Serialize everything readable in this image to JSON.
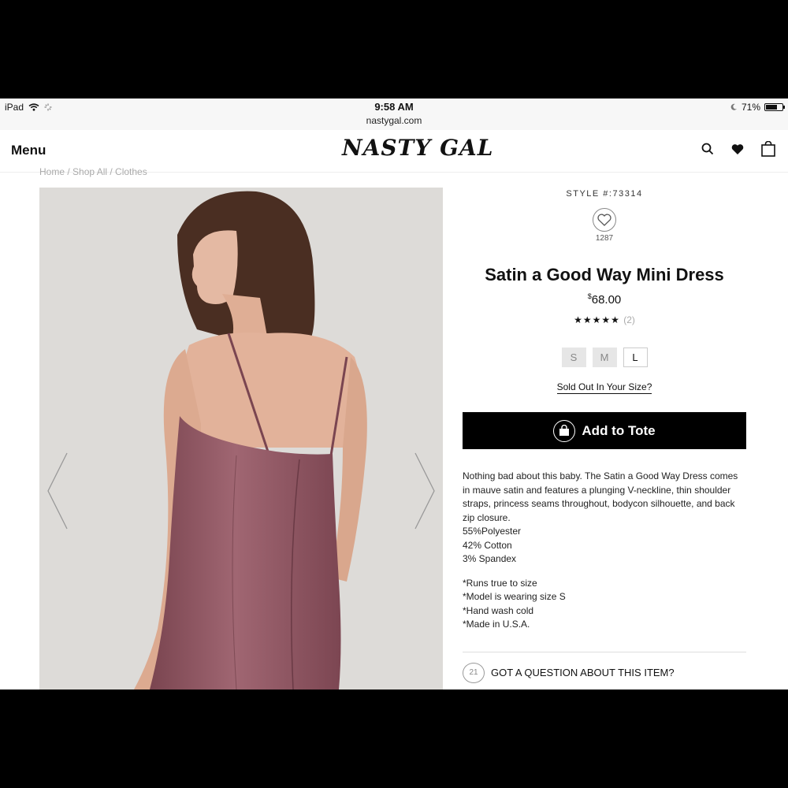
{
  "status_bar": {
    "device": "iPad",
    "time": "9:58 AM",
    "url": "nastygal.com",
    "battery": "71%",
    "battery_level": 0.71
  },
  "header": {
    "menu_label": "Menu",
    "logo_text": "NASTY GAL",
    "icons": [
      "search-icon",
      "heart-icon",
      "bag-icon"
    ]
  },
  "breadcrumb": "Home / Shop All / Clothes",
  "product": {
    "style_number": "STYLE #:73314",
    "favorites_count": "1287",
    "title": "Satin a Good Way Mini Dress",
    "price_currency": "$",
    "price_value": "68.00",
    "stars": "★★★★★",
    "review_count": "(2)",
    "sizes": [
      "S",
      "M",
      "L"
    ],
    "sold_out_link": "Sold Out In Your Size?",
    "add_to_tote_label": "Add to Tote",
    "description": "Nothing bad about this baby. The Satin a Good Way Dress comes in mauve satin and features a plunging V-neckline, thin shoulder straps, princess seams throughout, bodycon silhouette, and back zip closure.",
    "composition": [
      "55%Polyester",
      "42% Cotton",
      "3% Spandex"
    ],
    "notes": [
      "*Runs true to size",
      "*Model is wearing size S",
      "*Hand wash cold",
      "*Made in U.S.A."
    ],
    "question_count": "21",
    "question_label": "GOT A QUESTION ABOUT THIS ITEM?"
  },
  "colors": {
    "dress": "#8e5560",
    "background": "#dcdad7",
    "button": "#000000"
  }
}
